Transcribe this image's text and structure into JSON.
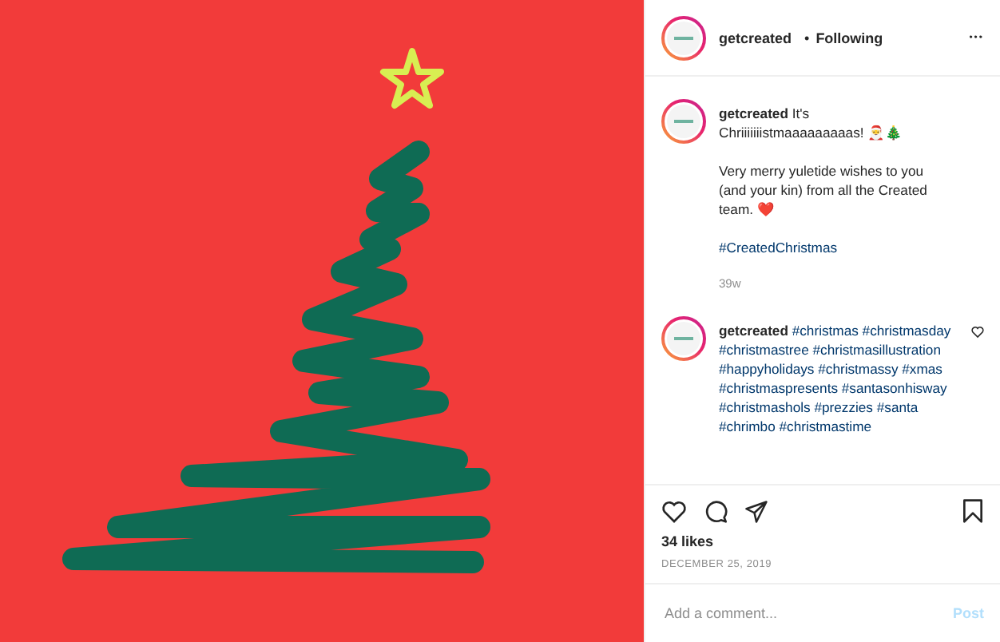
{
  "post": {
    "username": "getcreated",
    "separator": "•",
    "follow_status": "Following",
    "more": "•••"
  },
  "comments": [
    {
      "author": "getcreated",
      "paragraphs": [
        [
          {
            "kind": "text",
            "text": "It's Chriiiiiiistmaaaaaaaaas! 🎅🎄"
          }
        ],
        [
          {
            "kind": "text",
            "text": "Very merry yuletide wishes to you (and your kin) from all the Created team. ❤️"
          }
        ],
        [
          {
            "kind": "hashtag",
            "text": "#CreatedChristmas"
          }
        ]
      ],
      "time": "39w",
      "like_button": false
    },
    {
      "author": "getcreated",
      "paragraphs": [
        [
          {
            "kind": "hashtag",
            "text": "#christmas"
          },
          {
            "kind": "hashtag",
            "text": "#christmasday"
          },
          {
            "kind": "hashtag",
            "text": "#christmastree"
          },
          {
            "kind": "hashtag",
            "text": "#christmasillustration"
          },
          {
            "kind": "hashtag",
            "text": "#happyholidays"
          },
          {
            "kind": "hashtag",
            "text": "#christmassy"
          },
          {
            "kind": "hashtag",
            "text": "#xmas"
          },
          {
            "kind": "hashtag",
            "text": "#christmaspresents"
          },
          {
            "kind": "hashtag",
            "text": "#santasonhisway"
          },
          {
            "kind": "hashtag",
            "text": "#christmashols"
          },
          {
            "kind": "hashtag",
            "text": "#prezzies"
          },
          {
            "kind": "hashtag",
            "text": "#santa"
          },
          {
            "kind": "hashtag",
            "text": "#chrimbo"
          },
          {
            "kind": "hashtag",
            "text": "#christmastime"
          }
        ]
      ],
      "like_button": true
    }
  ],
  "likes": "34 likes",
  "date": "DECEMBER 25, 2019",
  "saved": false,
  "comment_field": {
    "placeholder": "Add a comment...",
    "post_button": "Post"
  }
}
